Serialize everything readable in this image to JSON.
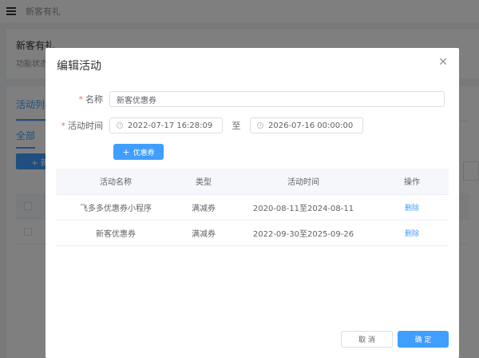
{
  "header": {
    "breadcrumb": "新客有礼"
  },
  "page": {
    "title": "新客有礼",
    "status_text": "功能状态：",
    "list_tab": "活动列表",
    "filter_tab": "全部",
    "add_button": "+ 新"
  },
  "dialog": {
    "title": "编辑活动",
    "name_label": "名称",
    "name_value": "新客优惠券",
    "time_label": "活动时间",
    "start_time": "2022-07-17 16:28:09",
    "range_separator": "至",
    "end_time": "2026-07-16 00:00:00",
    "coupon_button": "优惠券",
    "table": {
      "headers": [
        "活动名称",
        "类型",
        "活动时间",
        "操作"
      ],
      "rows": [
        {
          "name": "飞多多优惠券小程序",
          "type": "满减券",
          "period": "2020-08-11至2024-08-11",
          "action": "删除"
        },
        {
          "name": "新客优惠券",
          "type": "满减券",
          "period": "2022-09-30至2025-09-26",
          "action": "删除"
        }
      ]
    },
    "cancel_button": "取 消",
    "confirm_button": "确 定"
  },
  "colors": {
    "primary": "#409eff",
    "required": "#f56c6c"
  },
  "icons": {
    "menu": "hamburger-icon",
    "close": "close-icon",
    "date": "clock-icon",
    "add": "plus-icon"
  }
}
